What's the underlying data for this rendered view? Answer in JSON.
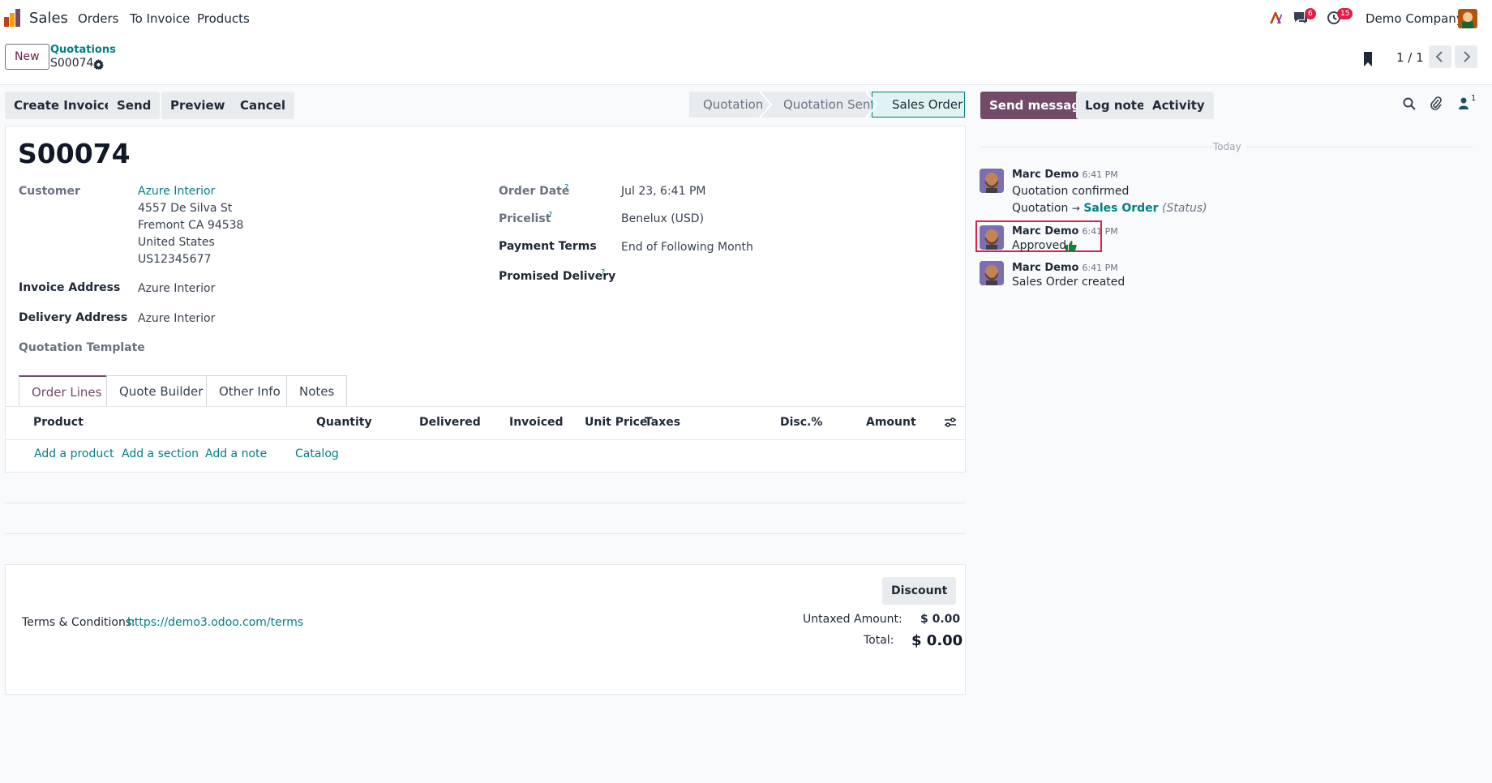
{
  "topbar": {
    "app_name": "Sales",
    "menu": [
      "Orders",
      "To Invoice",
      "Products"
    ],
    "messages_count": "6",
    "activities_count": "15",
    "company": "Demo Company"
  },
  "control": {
    "new_label": "New",
    "breadcrumb_parent": "Quotations",
    "record_name": "S00074",
    "pager": "1 / 1"
  },
  "actions": {
    "create_invoice": "Create Invoice",
    "send": "Send",
    "preview": "Preview",
    "cancel": "Cancel"
  },
  "status": [
    "Quotation",
    "Quotation Sent",
    "Sales Order"
  ],
  "chatter_actions": {
    "send_message": "Send message",
    "log_note": "Log note",
    "activity": "Activity",
    "followers_count": "1"
  },
  "form": {
    "title": "S00074",
    "customer_label": "Customer",
    "customer_name": "Azure Interior",
    "address": [
      "4557 De Silva St",
      "Fremont CA 94538",
      "United States",
      "US12345677"
    ],
    "invoice_address_label": "Invoice Address",
    "invoice_address": "Azure Interior",
    "delivery_address_label": "Delivery Address",
    "delivery_address": "Azure Interior",
    "quotation_template_label": "Quotation Template",
    "order_date_label": "Order Date",
    "order_date": "Jul 23, 6:41 PM",
    "pricelist_label": "Pricelist",
    "pricelist": "Benelux (USD)",
    "payment_terms_label": "Payment Terms",
    "payment_terms": "End of Following Month",
    "promised_delivery_label": "Promised Delivery",
    "help_mark": "?"
  },
  "tabs": [
    "Order Lines",
    "Quote Builder",
    "Other Info",
    "Notes"
  ],
  "table": {
    "headers": [
      "Product",
      "Quantity",
      "Delivered",
      "Invoiced",
      "Unit Price",
      "Taxes",
      "Disc.%",
      "Amount"
    ],
    "add_product": "Add a product",
    "add_section": "Add a section",
    "add_note": "Add a note",
    "catalog": "Catalog"
  },
  "footer": {
    "discount": "Discount",
    "terms_label": "Terms & Conditions:",
    "terms_link": "https://demo3.odoo.com/terms",
    "untaxed_label": "Untaxed Amount:",
    "untaxed_value": "$ 0.00",
    "total_label": "Total:",
    "total_value": "$ 0.00"
  },
  "chatter": {
    "day": "Today",
    "messages": [
      {
        "author": "Marc Demo",
        "time": "6:41 PM",
        "body": "Quotation confirmed",
        "change_from": "Quotation",
        "arrow": "→",
        "change_to": "Sales Order",
        "field": "(Status)"
      },
      {
        "author": "Marc Demo",
        "time": "6:41 PM",
        "body": "Approved"
      },
      {
        "author": "Marc Demo",
        "time": "6:41 PM",
        "body": "Sales Order created"
      }
    ]
  },
  "colors": {
    "brand": "#714b67",
    "link": "#017e84",
    "highlight": "#e11d48"
  }
}
